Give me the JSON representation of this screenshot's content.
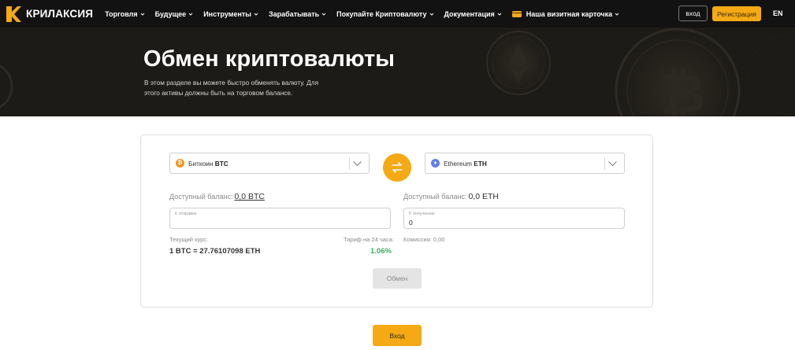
{
  "brand": {
    "name": "КРИЛАКСИЯ",
    "accent": "#f5a915"
  },
  "nav": {
    "items": [
      {
        "label": "Торговля"
      },
      {
        "label": "Будущее"
      },
      {
        "label": "Инструменты"
      },
      {
        "label": "Зарабатывать"
      },
      {
        "label": "Покупайте Криптовалюту"
      },
      {
        "label": "Документация"
      },
      {
        "label": "Наша визитная карточка"
      }
    ],
    "login_label": "вход",
    "register_label": "Регистрация",
    "language": "EN"
  },
  "hero": {
    "title": "Обмен криптовалюты",
    "subtitle": "В этом разделе вы можете быстро обменять валюту. Для этого активы должны быть на торговом балансе."
  },
  "exchange": {
    "from": {
      "coin_name": "Биткоин",
      "coin_ticker": "BTC",
      "icon": "bitcoin-icon",
      "icon_color": "#f7931a",
      "balance_label": "Доступный баланс:",
      "balance_value": "0,0 BTC",
      "input_label": "К отправке",
      "input_value": ""
    },
    "to": {
      "coin_name": "Ethereum",
      "coin_ticker": "ETH",
      "icon": "ethereum-icon",
      "icon_color": "#627eea",
      "balance_label": "Доступный баланс:",
      "balance_value": "0,0 ETH",
      "input_label": "К получению",
      "input_value": "0"
    },
    "rate_label": "Текущий курс:",
    "rate_value": "1 BTC = 27.76107098 ETH",
    "tariff_label": "Тариф на 24 часа:",
    "tariff_value": "1.06%",
    "commission_label": "Комиссия: 0,00",
    "exchange_button": "Обмен",
    "enter_button": "Вход"
  }
}
